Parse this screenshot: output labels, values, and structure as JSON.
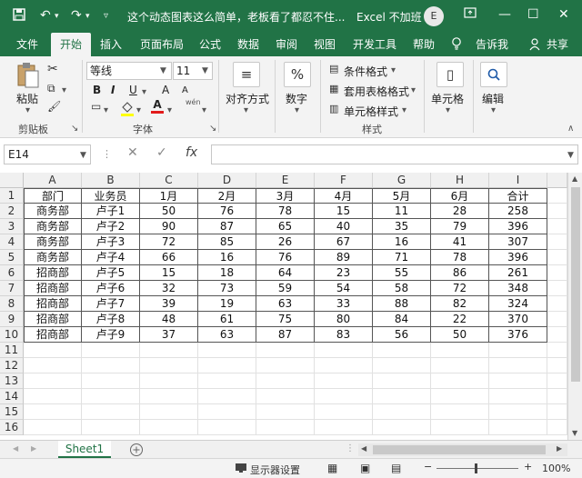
{
  "titlebar": {
    "save_icon": "save-icon",
    "title": "这个动态图表这么简单，老板看了都忍不住...",
    "account": "Excel 不加班",
    "avatar_letter": "E",
    "restore_icon": "ribbon-display-icon",
    "minimize": "—",
    "maximize": "☐",
    "close": "✕"
  },
  "menu": {
    "tabs": [
      "文件",
      "开始",
      "插入",
      "页面布局",
      "公式",
      "数据",
      "审阅",
      "视图",
      "开发工具",
      "帮助",
      "告诉我",
      "共享"
    ],
    "active": "开始"
  },
  "ribbon": {
    "paste_label": "粘贴",
    "clipboard_label": "剪贴板",
    "font_name": "等线",
    "font_size": "11",
    "font_group_label": "字体",
    "bold": "B",
    "italic": "I",
    "underline": "U",
    "grow": "A",
    "shrink": "A",
    "font_color_letter": "A",
    "wen": "wén",
    "align_label": "对齐方式",
    "number_label": "数字",
    "cond_format": "条件格式",
    "table_format": "套用表格格式",
    "cell_style": "单元格样式",
    "styles_label": "样式",
    "cells_label": "单元格",
    "edit_label": "编辑",
    "percent": "%"
  },
  "formula": {
    "namebox": "E14",
    "fx": "fx",
    "cancel": "✕",
    "confirm": "✓"
  },
  "sheet": {
    "columns": [
      "A",
      "B",
      "C",
      "D",
      "E",
      "F",
      "G",
      "H",
      "I"
    ],
    "rows": [
      "1",
      "2",
      "3",
      "4",
      "5",
      "6",
      "7",
      "8",
      "9",
      "10",
      "11",
      "12",
      "13",
      "14",
      "15",
      "16"
    ],
    "table": [
      [
        "部门",
        "业务员",
        "1月",
        "2月",
        "3月",
        "4月",
        "5月",
        "6月",
        "合计"
      ],
      [
        "商务部",
        "卢子1",
        "50",
        "76",
        "78",
        "15",
        "11",
        "28",
        "258"
      ],
      [
        "商务部",
        "卢子2",
        "90",
        "87",
        "65",
        "40",
        "35",
        "79",
        "396"
      ],
      [
        "商务部",
        "卢子3",
        "72",
        "85",
        "26",
        "67",
        "16",
        "41",
        "307"
      ],
      [
        "商务部",
        "卢子4",
        "66",
        "16",
        "76",
        "89",
        "71",
        "78",
        "396"
      ],
      [
        "招商部",
        "卢子5",
        "15",
        "18",
        "64",
        "23",
        "55",
        "86",
        "261"
      ],
      [
        "招商部",
        "卢子6",
        "32",
        "73",
        "59",
        "54",
        "58",
        "72",
        "348"
      ],
      [
        "招商部",
        "卢子7",
        "39",
        "19",
        "63",
        "33",
        "88",
        "82",
        "324"
      ],
      [
        "招商部",
        "卢子8",
        "48",
        "61",
        "75",
        "80",
        "84",
        "22",
        "370"
      ],
      [
        "招商部",
        "卢子9",
        "37",
        "63",
        "87",
        "83",
        "56",
        "50",
        "376"
      ]
    ],
    "tab_name": "Sheet1"
  },
  "status": {
    "display_settings": "显示器设置",
    "zoom": "100%"
  }
}
